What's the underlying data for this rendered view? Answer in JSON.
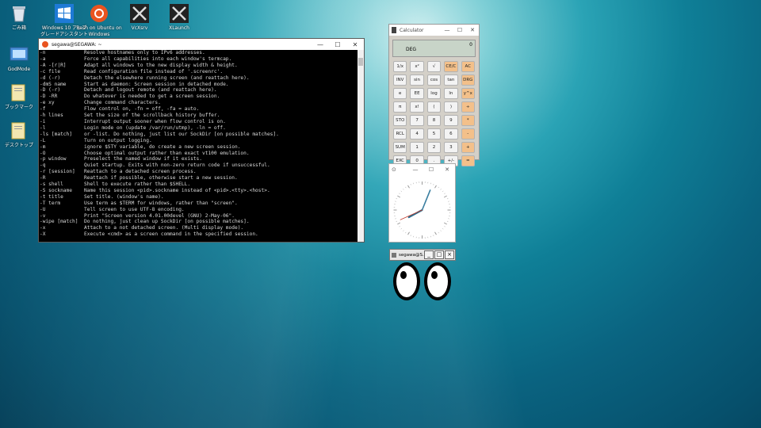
{
  "desktop": {
    "icons": [
      {
        "label": "ごみ箱",
        "icon": "recycle-bin-icon"
      },
      {
        "label": "Windows 10 アップグレードアシスタント",
        "icon": "windows-logo-icon"
      },
      {
        "label": "Bash on Ubuntu on Windows",
        "icon": "ubuntu-icon"
      },
      {
        "label": "VcXsrv",
        "icon": "x-icon"
      },
      {
        "label": "XLaunch",
        "icon": "x-icon"
      },
      {
        "label": "GodMode",
        "icon": "control-panel-icon"
      },
      {
        "label": "ブックマーク",
        "icon": "folder-icon"
      },
      {
        "label": "デスクトップ",
        "icon": "folder-icon"
      }
    ]
  },
  "terminal": {
    "title": "segawa@SEGAWA: ~",
    "lines": [
      [
        "-n",
        "Resolve hostnames only to IPv6 addresses."
      ],
      [
        "-a",
        "Force all capabilities into each window's termcap."
      ],
      [
        "-A -[r|R]",
        "Adapt all windows to the new display width & height."
      ],
      [
        "-c file",
        "Read configuration file instead of '.screenrc'."
      ],
      [
        "-d (-r)",
        "Detach the elsewhere running screen (and reattach here)."
      ],
      [
        "-dmS name",
        "Start as daemon: Screen session in detached mode."
      ],
      [
        "-D (-r)",
        "Detach and logout remote (and reattach here)."
      ],
      [
        "-D -RR",
        "Do whatever is needed to get a screen session."
      ],
      [
        "-e xy",
        "Change command characters."
      ],
      [
        "-f",
        "Flow control on, -fn = off, -fa = auto."
      ],
      [
        "-h lines",
        "Set the size of the scrollback history buffer."
      ],
      [
        "-i",
        "Interrupt output sooner when flow control is on."
      ],
      [
        "-l",
        "Login mode on (update /var/run/utmp), -ln = off."
      ],
      [
        "-ls [match]",
        "or -list. Do nothing, just list our SockDir [on possible matches]."
      ],
      [
        "-L",
        "Turn on output logging."
      ],
      [
        "-m",
        "ignore $STY variable, do create a new screen session."
      ],
      [
        "-O",
        "Choose optimal output rather than exact vt100 emulation."
      ],
      [
        "-p window",
        "Preselect the named window if it exists."
      ],
      [
        "-q",
        "Quiet startup. Exits with non-zero return code if unsuccessful."
      ],
      [
        "-r [session]",
        "Reattach to a detached screen process."
      ],
      [
        "-R",
        "Reattach if possible, otherwise start a new session."
      ],
      [
        "-s shell",
        "Shell to execute rather than $SHELL."
      ],
      [
        "-S sockname",
        "Name this session <pid>.sockname instead of <pid>.<tty>.<host>."
      ],
      [
        "-t title",
        "Set title. (window's name)."
      ],
      [
        "-T term",
        "Use term as $TERM for windows, rather than \"screen\"."
      ],
      [
        "-U",
        "Tell screen to use UTF-8 encoding."
      ],
      [
        "-v",
        "Print \"Screen version 4.01.00devel (GNU) 2-May-06\"."
      ],
      [
        "-wipe [match]",
        "Do nothing, just clean up SockDir [on possible matches]."
      ],
      [
        "-x",
        "Attach to a not detached screen. (Multi display mode)."
      ],
      [
        "-X",
        "Execute <cmd> as a screen command in the specified session."
      ]
    ]
  },
  "calculator": {
    "title": "Calculator",
    "mode": "DEG",
    "display": "0",
    "keys": [
      "1/x",
      "x²",
      "√",
      "CE/C",
      "AC",
      "INV",
      "sin",
      "cos",
      "tan",
      "DRG",
      "e",
      "EE",
      "log",
      "ln",
      "y^x",
      "π",
      "x!",
      "(",
      ")",
      "÷",
      "STO",
      "7",
      "8",
      "9",
      "*",
      "RCL",
      "4",
      "5",
      "6",
      "-",
      "SUM",
      "1",
      "2",
      "3",
      "+",
      "EXC",
      "0",
      ".",
      "+/-",
      "="
    ]
  },
  "clock": {
    "hour": 8,
    "minute": 3,
    "second": 41
  },
  "xeyes": {
    "title": "segawa@S..."
  }
}
